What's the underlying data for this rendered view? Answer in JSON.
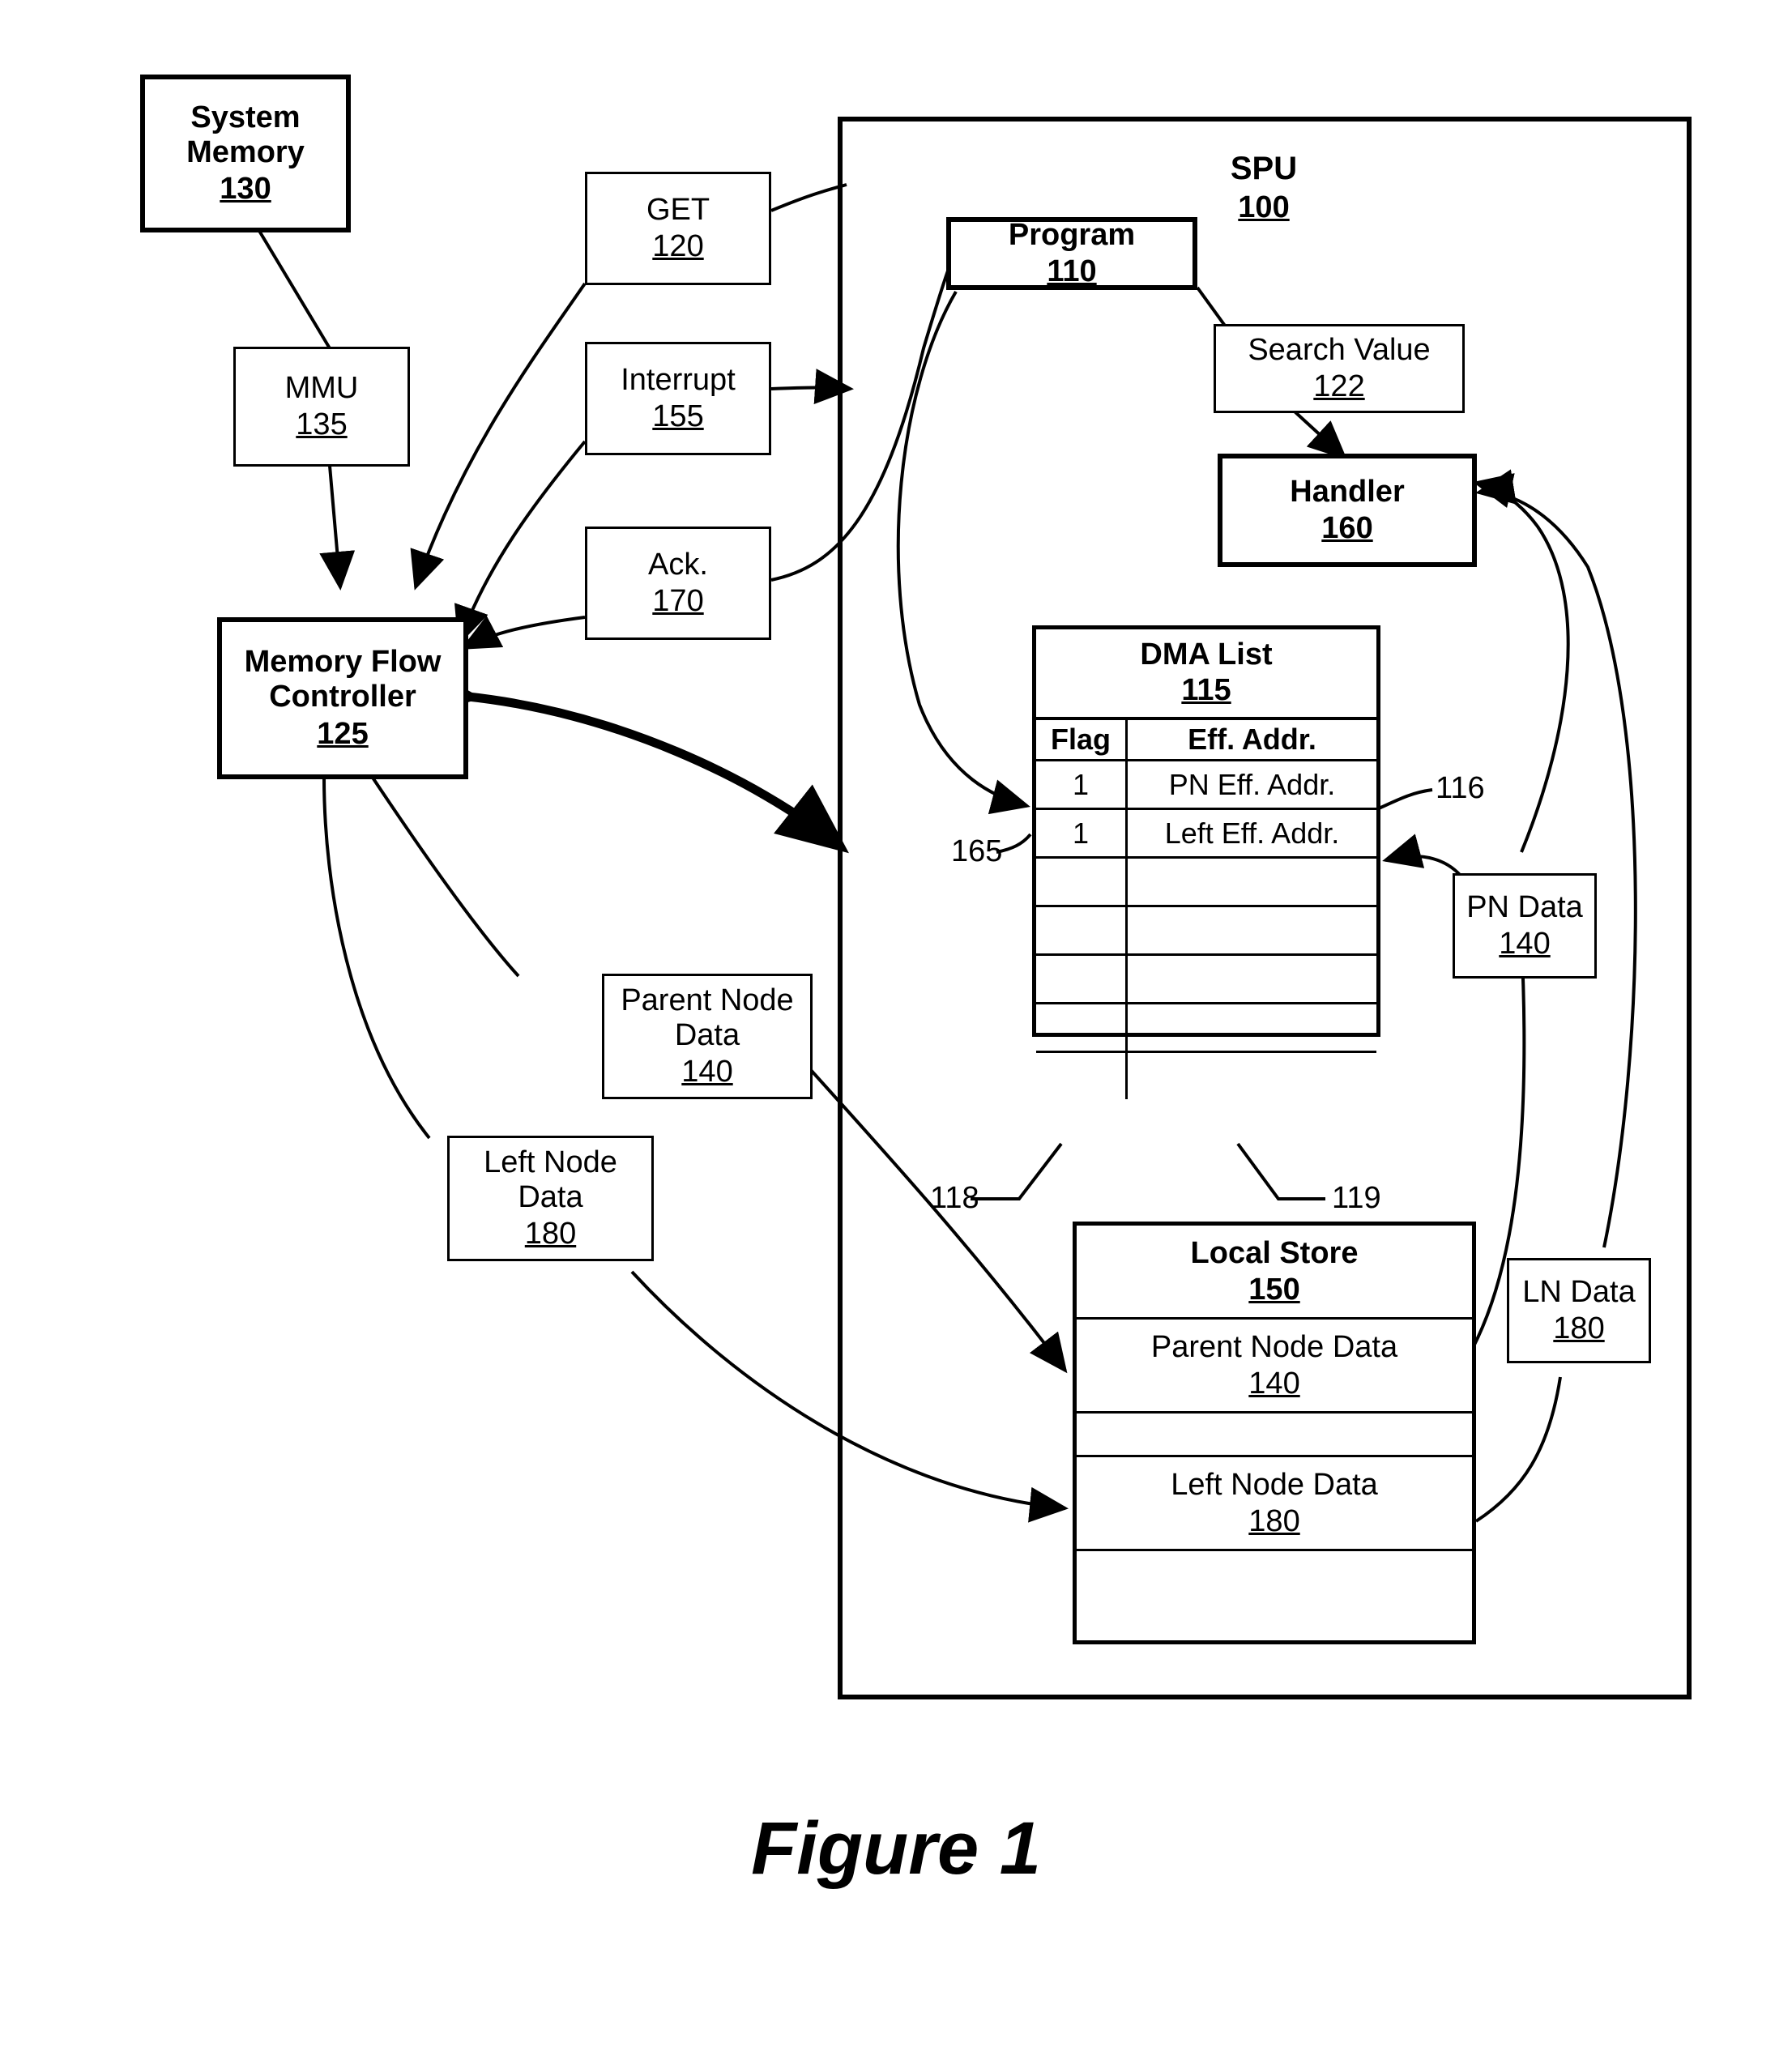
{
  "figure": {
    "caption": "Figure 1"
  },
  "spu": {
    "title": "SPU",
    "number": "100"
  },
  "boxes": {
    "system_memory": {
      "label": "System\nMemory",
      "line1": "System",
      "line2": "Memory",
      "number": "130"
    },
    "mmu": {
      "label": "MMU",
      "number": "135"
    },
    "get": {
      "label": "GET",
      "number": "120"
    },
    "interrupt": {
      "label": "Interrupt",
      "number": "155"
    },
    "ack": {
      "label": "Ack.",
      "number": "170"
    },
    "mfc": {
      "line1": "Memory Flow",
      "line2": "Controller",
      "number": "125"
    },
    "parent_node_data": {
      "line1": "Parent Node",
      "line2": "Data",
      "number": "140"
    },
    "left_node_data": {
      "line1": "Left Node",
      "line2": "Data",
      "number": "180"
    },
    "program": {
      "label": "Program",
      "number": "110"
    },
    "search_value": {
      "label": "Search Value",
      "number": "122"
    },
    "handler": {
      "label": "Handler",
      "number": "160"
    },
    "pn_data": {
      "label": "PN Data",
      "number": "140"
    },
    "ln_data": {
      "label": "LN Data",
      "number": "180"
    }
  },
  "dma_list": {
    "title": "DMA List",
    "number": "115",
    "columns": [
      "Flag",
      "Eff. Addr."
    ],
    "rows": [
      {
        "flag": "1",
        "addr": "PN Eff. Addr."
      },
      {
        "flag": "1",
        "addr": "Left Eff. Addr."
      },
      {
        "flag": "",
        "addr": ""
      },
      {
        "flag": "",
        "addr": ""
      },
      {
        "flag": "",
        "addr": ""
      },
      {
        "flag": "",
        "addr": ""
      },
      {
        "flag": "",
        "addr": ""
      }
    ]
  },
  "local_store": {
    "title": "Local Store",
    "number": "150",
    "segments": [
      {
        "label": "Parent Node Data",
        "number": "140"
      },
      {
        "label": "",
        "number": ""
      },
      {
        "label": "Left Node Data",
        "number": "180"
      },
      {
        "label": "",
        "number": ""
      }
    ]
  },
  "reference_numerals": {
    "ref_116": "116",
    "ref_165": "165",
    "ref_118": "118",
    "ref_119": "119"
  },
  "colors": {
    "line": "#000000",
    "background": "#ffffff"
  }
}
